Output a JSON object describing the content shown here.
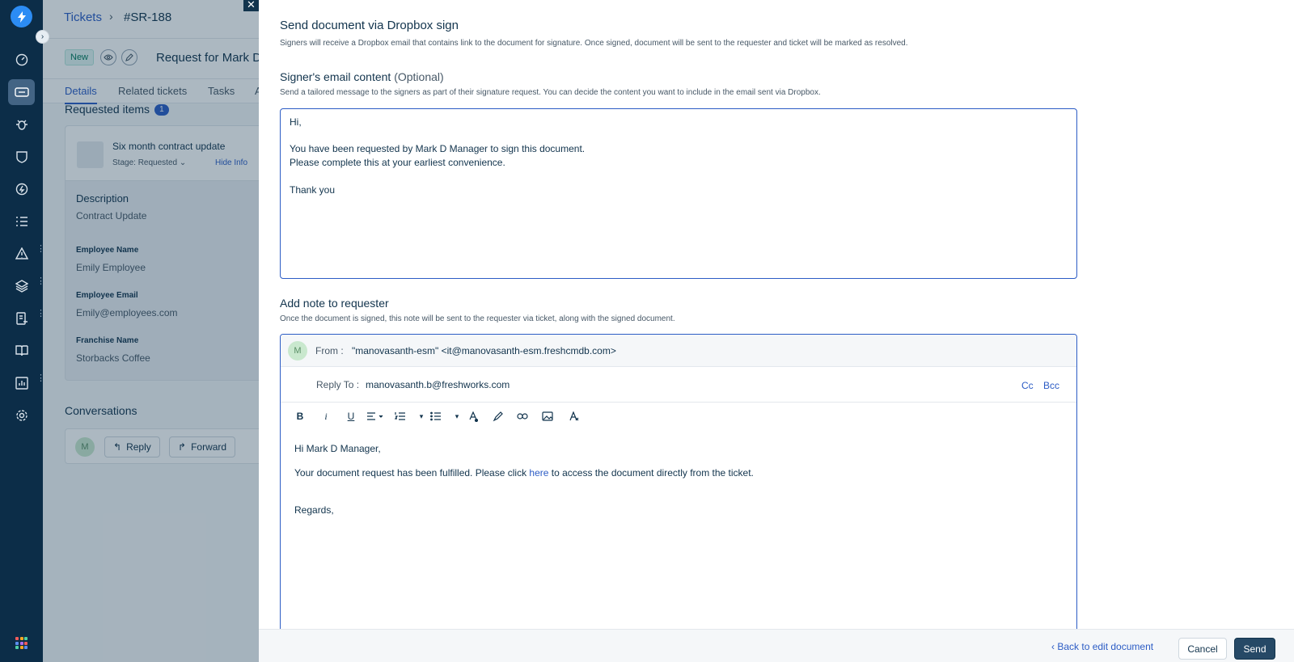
{
  "header": {
    "breadcrumb_root": "Tickets",
    "breadcrumb_sep": "›",
    "ticket_id": "#SR-188"
  },
  "ticket": {
    "status_badge": "New",
    "title": "Request for Mark D",
    "tabs": [
      "Details",
      "Related tickets",
      "Tasks",
      "A"
    ],
    "requested_items_label": "Requested items",
    "requested_items_count": "1",
    "item": {
      "name": "Six month contract update",
      "stage_label": "Stage:",
      "stage_value": "Requested",
      "hide_info": "Hide Info"
    },
    "description_label": "Description",
    "description_value": "Contract Update",
    "fields": [
      {
        "label": "Employee Name",
        "value": "Emily Employee"
      },
      {
        "label": "Employee Email",
        "value": "Emily@employees.com"
      },
      {
        "label": "Franchise Name",
        "value": "Storbacks Coffee"
      }
    ],
    "conversations_label": "Conversations",
    "avatar_initial": "M",
    "reply_label": "Reply",
    "forward_label": "Forward"
  },
  "panel": {
    "title": "Send document via Dropbox sign",
    "description": "Signers will receive a Dropbox email that contains link to the document for signature. Once signed, document will be sent to the requester and ticket will be marked as resolved.",
    "email_section_title": "Signer's email content",
    "email_section_optional": "(Optional)",
    "email_section_desc": "Send a tailored message to the signers as part of their signature request. You can decide the content you want to include in the email sent via Dropbox.",
    "email_content": "Hi,\n\nYou have been requested by Mark D Manager to sign this document.\nPlease complete this at your earliest convenience.\n\nThank you",
    "note_title": "Add note to requester",
    "note_desc": "Once the document is signed, this note will be sent to the requester via ticket, along with the signed document.",
    "from_avatar": "M",
    "from_label": "From :",
    "from_value": "\"manovasanth-esm\" <it@manovasanth-esm.freshcmdb.com>",
    "reply_to_label": "Reply To :",
    "reply_to_value": "manovasanth.b@freshworks.com",
    "cc_label": "Cc",
    "bcc_label": "Bcc",
    "body_greeting": "Hi Mark D Manager,",
    "body_line_prefix": "Your document request has been fulfilled. Please click",
    "body_link": "here",
    "body_line_suffix": "to access the document directly from the ticket.",
    "body_regards": "Regards,"
  },
  "footer": {
    "back_label": "Back to edit document",
    "cancel_label": "Cancel",
    "send_label": "Send"
  },
  "colors": {
    "sidebar": "#0c2d48",
    "accent": "#2c5cc5",
    "primary_button": "#264966"
  }
}
